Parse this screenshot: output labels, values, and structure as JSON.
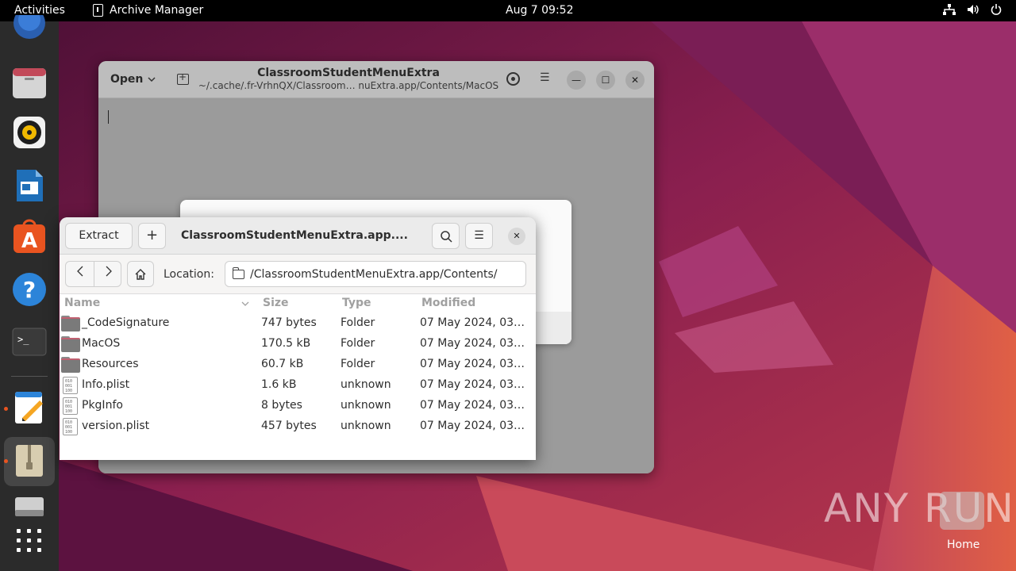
{
  "topbar": {
    "activities": "Activities",
    "app_name": "Archive Manager",
    "clock": "Aug 7  09:52"
  },
  "dock": {
    "items": [
      "firefox-icon",
      "files-icon",
      "rhythmbox-icon",
      "libreoffice-writer-icon",
      "app-center-icon",
      "help-icon",
      "terminal-icon",
      "text-editor-icon",
      "archive-manager-icon",
      "disk-icon",
      "show-apps-icon"
    ]
  },
  "editor_window": {
    "open_label": "Open",
    "title": "ClassroomStudentMenuExtra",
    "subtitle": "~/.cache/.fr-VrhnQX/Classroom… nuExtra.app/Contents/MacOS"
  },
  "archive_window": {
    "extract_label": "Extract",
    "title": "ClassroomStudentMenuExtra.app....",
    "location_label": "Location:",
    "location_path": "/ClassroomStudentMenuExtra.app/Contents/",
    "columns": {
      "name": "Name",
      "size": "Size",
      "type": "Type",
      "modified": "Modified"
    },
    "rows": [
      {
        "name": "_CodeSignature",
        "size": "747 bytes",
        "type": "Folder",
        "modified": "07 May 2024, 03…",
        "icon": "folder"
      },
      {
        "name": "MacOS",
        "size": "170.5 kB",
        "type": "Folder",
        "modified": "07 May 2024, 03…",
        "icon": "folder"
      },
      {
        "name": "Resources",
        "size": "60.7 kB",
        "type": "Folder",
        "modified": "07 May 2024, 03…",
        "icon": "folder"
      },
      {
        "name": "Info.plist",
        "size": "1.6 kB",
        "type": "unknown",
        "modified": "07 May 2024, 03…",
        "icon": "binary-file"
      },
      {
        "name": "PkgInfo",
        "size": "8 bytes",
        "type": "unknown",
        "modified": "07 May 2024, 03…",
        "icon": "binary-file"
      },
      {
        "name": "version.plist",
        "size": "457 bytes",
        "type": "unknown",
        "modified": "07 May 2024, 03…",
        "icon": "binary-file"
      }
    ]
  },
  "desktop": {
    "watermark": "ANY RUN",
    "home_label": "Home"
  },
  "colors": {
    "accent": "#e95420",
    "topbar": "#000000",
    "dock": "#2b2b2b"
  }
}
